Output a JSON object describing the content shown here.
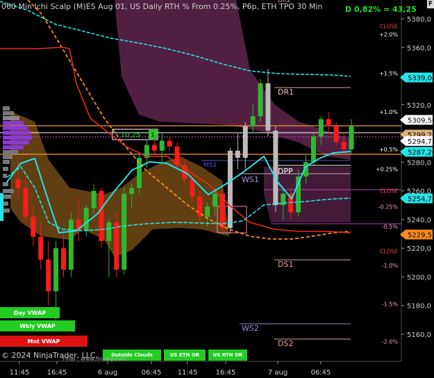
{
  "header": {
    "title": "060 Min Ichi Scalp (M)ES Aug 01, US Daily RTH % From 0.25%, P6p, ETH TPO 30 Min",
    "top_label": "DR2",
    "delta_text": "D 0,82% = 43,25",
    "corner_label": "F"
  },
  "footer": {
    "copyright": "© 2024 NinjaTrader, LLC",
    "url": "Final : www.fin-alg.com"
  },
  "colors": {
    "background": "#000000",
    "bull_candle": "#2fb82f",
    "bear_candle": "#ff1a1a",
    "faded_candle": "#bbbbbb",
    "cyan_line": "#22e5ea",
    "red_line": "#ee2a1a",
    "orange_curve": "#ff8c1a",
    "cloud_orange": "#8a5a1a",
    "cloud_purple": "#5a2448",
    "vwap_green": "#22cc22",
    "vwap_red": "#dd1111"
  },
  "vwap_buttons": [
    {
      "label": "Day VWAP",
      "color": "#22cc22"
    },
    {
      "label": "Wkly VWAP",
      "color": "#22cc22"
    },
    {
      "label": "Mnt VWAP",
      "color": "#dd1111"
    }
  ],
  "session_buttons": [
    {
      "label": "Outside Clouds"
    },
    {
      "label": "US ETH OR"
    },
    {
      "label": "US RTH OR"
    }
  ],
  "chart_data": {
    "type": "candlestick",
    "x_ticks": [
      "11:45",
      "16:45",
      "6 aug",
      "06:45",
      "11:45",
      "16:45",
      "7 aug",
      "06:45"
    ],
    "y_ticks": [
      5160,
      5180,
      5200,
      5220,
      5240,
      5260,
      5280,
      5300,
      5320,
      5340,
      5360,
      5380
    ],
    "ylim": [
      5145,
      5390
    ],
    "price_labels": [
      {
        "text": "5339,04",
        "value": 5339.04,
        "color": "#22e5ea"
      },
      {
        "text": "5309,50",
        "value": 5309.5,
        "color": "#ffffff"
      },
      {
        "text": "5299,25",
        "value": 5299.25,
        "color": "#d9b07a"
      },
      {
        "text": "5294,75",
        "value": 5294.75,
        "color": "#ffffff"
      },
      {
        "text": "5287,20",
        "value": 5287.2,
        "color": "#22e5ea"
      },
      {
        "text": "5254,71",
        "value": 5254.71,
        "color": "#22e5ea"
      },
      {
        "text": "5229,51",
        "value": 5229.51,
        "color": "#ff8c1a"
      }
    ],
    "level_labels": [
      {
        "text": "DR1",
        "value": 5328
      },
      {
        "text": "DPP",
        "value": 5276
      },
      {
        "text": "WS1",
        "value": 5272
      },
      {
        "text": "MS1",
        "value": 5279
      },
      {
        "text": "DS1",
        "value": 5210
      },
      {
        "text": "WS2",
        "value": 5168
      },
      {
        "text": "DS2",
        "value": 5157
      }
    ],
    "percent_labels": [
      {
        "text": "CLOSE",
        "value": 5375
      },
      {
        "text": "+2.0%",
        "value": 5369
      },
      {
        "text": "+1.5%",
        "value": 5342
      },
      {
        "text": "+1.0%",
        "value": 5315
      },
      {
        "text": "+0.5%",
        "value": 5289
      },
      {
        "text": "+0.25%",
        "value": 5275
      },
      {
        "text": "CLOSE",
        "value": 5260
      },
      {
        "text": "-0.25%",
        "value": 5249
      },
      {
        "text": "-0.5%",
        "value": 5235
      },
      {
        "text": "CLOSE",
        "value": 5218
      },
      {
        "text": "-1.0%",
        "value": 5208
      },
      {
        "text": "-1.5%",
        "value": 5181
      },
      {
        "text": "-2.0%",
        "value": 5155
      }
    ],
    "box_label": {
      "text": "10,25",
      "count": "1"
    },
    "candles": [
      {
        "o": 5268,
        "h": 5280,
        "l": 5255,
        "c": 5262
      },
      {
        "o": 5262,
        "h": 5270,
        "l": 5238,
        "c": 5242
      },
      {
        "o": 5242,
        "h": 5250,
        "l": 5222,
        "c": 5228
      },
      {
        "o": 5228,
        "h": 5238,
        "l": 5205,
        "c": 5212
      },
      {
        "o": 5212,
        "h": 5225,
        "l": 5180,
        "c": 5190
      },
      {
        "o": 5190,
        "h": 5225,
        "l": 5170,
        "c": 5220
      },
      {
        "o": 5220,
        "h": 5230,
        "l": 5200,
        "c": 5205
      },
      {
        "o": 5205,
        "h": 5245,
        "l": 5200,
        "c": 5240
      },
      {
        "o": 5240,
        "h": 5255,
        "l": 5225,
        "c": 5232
      },
      {
        "o": 5232,
        "h": 5250,
        "l": 5228,
        "c": 5248
      },
      {
        "o": 5248,
        "h": 5265,
        "l": 5244,
        "c": 5260
      },
      {
        "o": 5260,
        "h": 5262,
        "l": 5220,
        "c": 5225
      },
      {
        "o": 5225,
        "h": 5240,
        "l": 5200,
        "c": 5238
      },
      {
        "o": 5238,
        "h": 5245,
        "l": 5200,
        "c": 5205
      },
      {
        "o": 5205,
        "h": 5262,
        "l": 5202,
        "c": 5258
      },
      {
        "o": 5258,
        "h": 5265,
        "l": 5248,
        "c": 5262
      },
      {
        "o": 5262,
        "h": 5285,
        "l": 5258,
        "c": 5283
      },
      {
        "o": 5283,
        "h": 5295,
        "l": 5276,
        "c": 5292
      },
      {
        "o": 5292,
        "h": 5298,
        "l": 5285,
        "c": 5288
      },
      {
        "o": 5288,
        "h": 5300,
        "l": 5280,
        "c": 5295
      },
      {
        "o": 5295,
        "h": 5298,
        "l": 5288,
        "c": 5291
      },
      {
        "o": 5291,
        "h": 5294,
        "l": 5275,
        "c": 5278
      },
      {
        "o": 5278,
        "h": 5282,
        "l": 5265,
        "c": 5268
      },
      {
        "o": 5268,
        "h": 5270,
        "l": 5252,
        "c": 5256
      },
      {
        "o": 5256,
        "h": 5260,
        "l": 5238,
        "c": 5242
      },
      {
        "o": 5242,
        "h": 5252,
        "l": 5235,
        "c": 5249
      },
      {
        "o": 5249,
        "h": 5262,
        "l": 5243,
        "c": 5258
      },
      {
        "o": 5258,
        "h": 5262,
        "l": 5232,
        "c": 5234
      },
      {
        "o": 5234,
        "h": 5290,
        "l": 5230,
        "c": 5288
      },
      {
        "o": 5288,
        "h": 5300,
        "l": 5275,
        "c": 5283
      },
      {
        "o": 5283,
        "h": 5308,
        "l": 5275,
        "c": 5305
      },
      {
        "o": 5305,
        "h": 5320,
        "l": 5300,
        "c": 5312
      },
      {
        "o": 5312,
        "h": 5338,
        "l": 5308,
        "c": 5335
      },
      {
        "o": 5335,
        "h": 5345,
        "l": 5298,
        "c": 5302
      },
      {
        "o": 5302,
        "h": 5305,
        "l": 5245,
        "c": 5250
      },
      {
        "o": 5250,
        "h": 5262,
        "l": 5240,
        "c": 5258
      },
      {
        "o": 5258,
        "h": 5262,
        "l": 5240,
        "c": 5245
      },
      {
        "o": 5245,
        "h": 5275,
        "l": 5242,
        "c": 5270
      },
      {
        "o": 5270,
        "h": 5285,
        "l": 5265,
        "c": 5280
      },
      {
        "o": 5280,
        "h": 5300,
        "l": 5278,
        "c": 5298
      },
      {
        "o": 5298,
        "h": 5312,
        "l": 5292,
        "c": 5310
      },
      {
        "o": 5310,
        "h": 5315,
        "l": 5300,
        "c": 5305
      },
      {
        "o": 5305,
        "h": 5308,
        "l": 5292,
        "c": 5294
      },
      {
        "o": 5294,
        "h": 5300,
        "l": 5285,
        "c": 5289
      },
      {
        "o": 5289,
        "h": 5310,
        "l": 5285,
        "c": 5305
      }
    ]
  }
}
